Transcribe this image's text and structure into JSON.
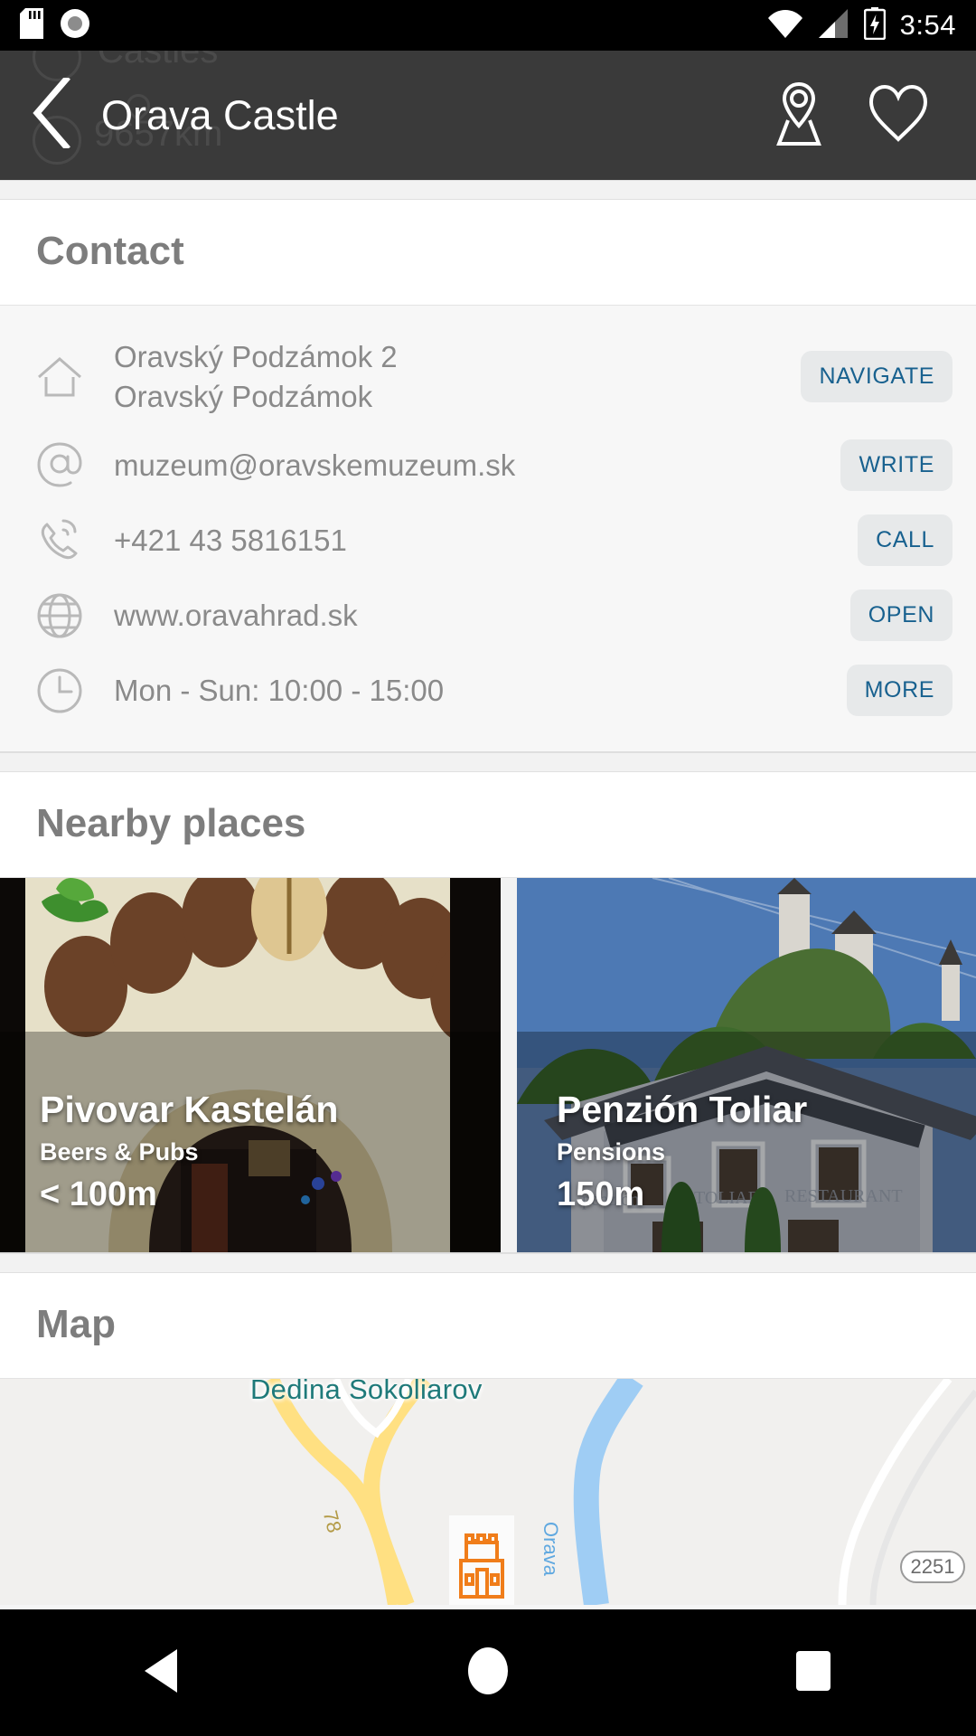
{
  "status_bar": {
    "icons_left": [
      "sd-card-icon",
      "record-icon"
    ],
    "icons_right": [
      "wifi-icon",
      "cellular-signal-icon",
      "battery-charging-icon"
    ],
    "time": "3:54"
  },
  "header": {
    "back_label": "back-chevron-icon",
    "title": "Orava Castle",
    "map_action": "show-on-map-icon",
    "favorite_action": "heart-icon",
    "background_ghost": {
      "category": "Castles",
      "distance": "9657km"
    },
    "background_color": "#3a3a3a"
  },
  "sections": {
    "contact": {
      "title": "Contact",
      "rows": [
        {
          "icon": "home-icon",
          "line1": "Oravský Podzámok 2",
          "line2": "Oravský Podzámok",
          "action": "NAVIGATE"
        },
        {
          "icon": "at-sign-icon",
          "line1": "muzeum@oravskemuzeum.sk",
          "line2": "",
          "action": "WRITE"
        },
        {
          "icon": "phone-icon",
          "line1": "+421 43 5816151",
          "line2": "",
          "action": "CALL"
        },
        {
          "icon": "globe-icon",
          "line1": "www.oravahrad.sk",
          "line2": "",
          "action": "OPEN"
        },
        {
          "icon": "clock-icon",
          "line1": "Mon - Sun: 10:00 - 15:00",
          "line2": "",
          "action": "MORE"
        }
      ]
    },
    "nearby": {
      "title": "Nearby places",
      "cards": [
        {
          "name": "Pivovar Kastelán",
          "category": "Beers & Pubs",
          "distance": "< 100m"
        },
        {
          "name": "Penzión Toliar",
          "category": "Pensions",
          "distance": "150m"
        }
      ]
    },
    "map": {
      "title": "Map",
      "labels": {
        "village": "Dedina Sokoliarov",
        "river": "Orava",
        "road": "78",
        "shield": "2251"
      },
      "poi_icon": "castle-marker-icon"
    }
  },
  "nav_bar": {
    "back": "back-triangle-icon",
    "home": "home-circle-icon",
    "recents": "recents-square-icon"
  },
  "colors": {
    "accent_blue": "#18618f",
    "pill_bg": "#e7e9ea",
    "section_title": "#7d7d7d",
    "body_text": "#8a8a8a",
    "toolbar": "#3a3a3a",
    "map_village": "#1f7a7a",
    "map_poi": "#f07d1a"
  }
}
